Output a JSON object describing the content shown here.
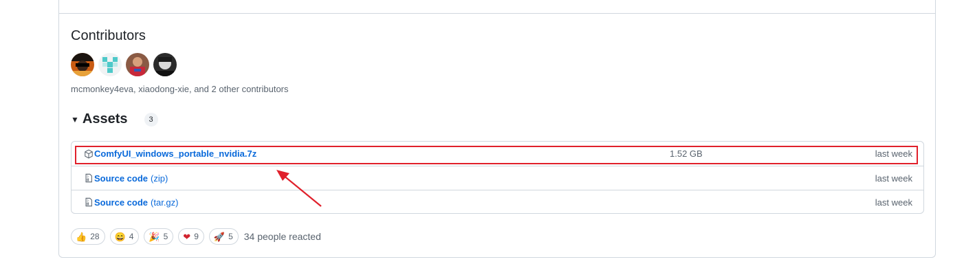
{
  "contributors": {
    "title": "Contributors",
    "summary": "mcmonkey4eva, xiaodong-xie, and 2 other contributors",
    "avatars": [
      "avatar-1",
      "avatar-2",
      "avatar-3",
      "avatar-4"
    ]
  },
  "assets": {
    "title": "Assets",
    "count": "3",
    "rows": [
      {
        "icon": "package-icon",
        "name": "ComfyUI_windows_portable_nvidia.7z",
        "ext": "",
        "size": "1.52 GB",
        "date": "last week"
      },
      {
        "icon": "file-zip-icon",
        "name": "Source code",
        "ext": "(zip)",
        "size": "",
        "date": "last week"
      },
      {
        "icon": "file-zip-icon",
        "name": "Source code",
        "ext": "(tar.gz)",
        "size": "",
        "date": "last week"
      }
    ]
  },
  "reactions": {
    "items": [
      {
        "emoji": "👍",
        "count": "28",
        "name": "thumbs-up"
      },
      {
        "emoji": "😄",
        "count": "4",
        "name": "laugh"
      },
      {
        "emoji": "🎉",
        "count": "5",
        "name": "hooray"
      },
      {
        "emoji": "❤",
        "count": "9",
        "name": "heart"
      },
      {
        "emoji": "🚀",
        "count": "5",
        "name": "rocket"
      }
    ],
    "summary": "34 people reacted"
  },
  "annotation": {
    "highlight_color": "#e0202b"
  }
}
